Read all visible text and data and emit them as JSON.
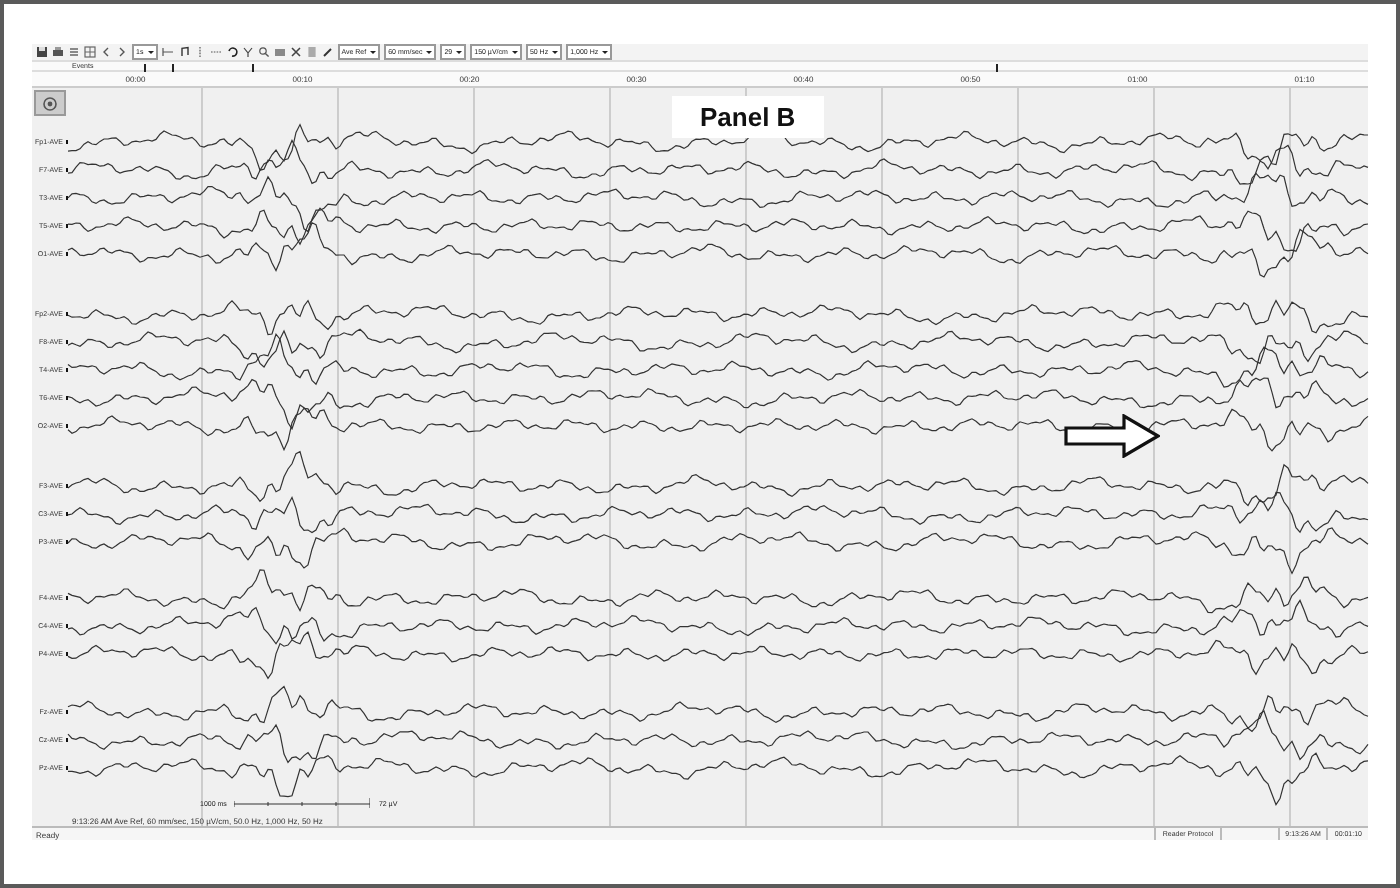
{
  "toolbar": {
    "page_dropdown": "1s",
    "dropdowns": [
      "Ave Ref",
      "60 mm/sec",
      "29",
      "150 µV/cm",
      "50 Hz",
      "1,000 Hz"
    ]
  },
  "events": {
    "label": "Events"
  },
  "time_ruler": [
    "00:00",
    "00:10",
    "00:20",
    "00:30",
    "00:40",
    "00:50",
    "01:00",
    "01:10"
  ],
  "panel_label": "Panel B",
  "groups": [
    {
      "channels": [
        {
          "label": "Fp1-AVE"
        },
        {
          "label": "F7-AVE"
        },
        {
          "label": "T3-AVE"
        },
        {
          "label": "T5-AVE"
        },
        {
          "label": "O1-AVE"
        }
      ]
    },
    {
      "channels": [
        {
          "label": "Fp2-AVE"
        },
        {
          "label": "F8-AVE"
        },
        {
          "label": "T4-AVE"
        },
        {
          "label": "T6-AVE"
        },
        {
          "label": "O2-AVE"
        }
      ]
    },
    {
      "channels": [
        {
          "label": "F3-AVE"
        },
        {
          "label": "C3-AVE"
        },
        {
          "label": "P3-AVE"
        }
      ]
    },
    {
      "channels": [
        {
          "label": "F4-AVE"
        },
        {
          "label": "C4-AVE"
        },
        {
          "label": "P4-AVE"
        }
      ]
    },
    {
      "channels": [
        {
          "label": "Fz-AVE"
        },
        {
          "label": "Cz-AVE"
        },
        {
          "label": "Pz-AVE"
        }
      ]
    }
  ],
  "scale": {
    "time": "1000 ms",
    "amplitude": "72 µV"
  },
  "montage_info": "9:13:26 AM Ave Ref, 60 mm/sec, 150 µV/cm, 50.0 Hz, 1,000 Hz, 50 Hz",
  "status_bar": {
    "state": "Ready",
    "protocol": "Reader Protocol",
    "time": "9:13:26 AM",
    "duration": "00:01:10"
  }
}
